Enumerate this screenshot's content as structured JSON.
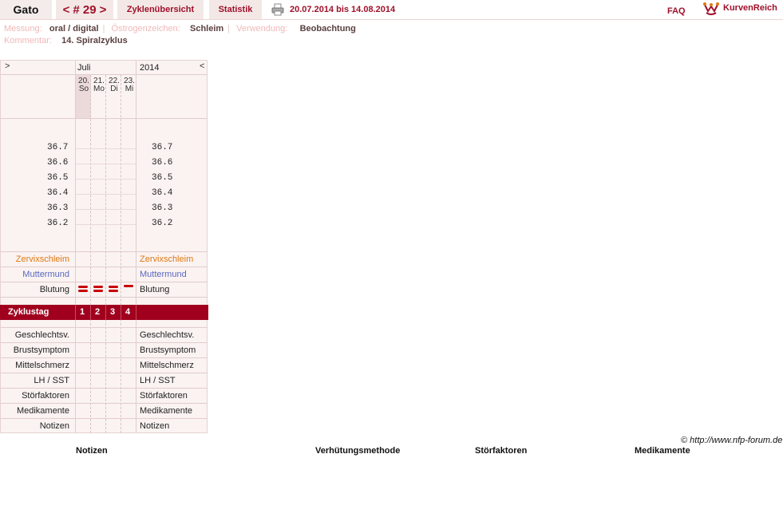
{
  "topbar": {
    "user": "Gato",
    "cycle_prev": "<",
    "cycle_label": "# 29",
    "cycle_next": ">",
    "overview_tab": "Zyklenübersicht",
    "stats_tab": "Statistik",
    "printer_icon": "printer-icon",
    "date_range": "20.07.2014 bis 14.08.2014",
    "faq": "FAQ",
    "logo_icon": "crown-icon",
    "logo_text": "KurvenReich"
  },
  "meta": {
    "messung_label": "Messung:",
    "messung_value": "oral / digital",
    "oestrogen_label": "Östrogenzeichen:",
    "oestrogen_value": "Schleim",
    "verwendung_label": "Verwendung:",
    "verwendung_value": "Beobachtung",
    "kommentar_label": "Kommentar:",
    "kommentar_value": "14. Spiralzyklus"
  },
  "chart": {
    "nav_left": ">",
    "nav_right": "<",
    "month": "Juli",
    "year": "2014",
    "days": [
      {
        "date": "20.",
        "weekday": "So",
        "bleeding": "heavy"
      },
      {
        "date": "21.",
        "weekday": "Mo",
        "bleeding": "heavy"
      },
      {
        "date": "22.",
        "weekday": "Di",
        "bleeding": "heavy"
      },
      {
        "date": "23.",
        "weekday": "Mi",
        "bleeding": "light"
      }
    ],
    "temperatures": [
      "36.7",
      "36.6",
      "36.5",
      "36.4",
      "36.3",
      "36.2"
    ],
    "rows_top": {
      "cervix": "Zervixschleim",
      "muttermund": "Muttermund",
      "blutung": "Blutung"
    },
    "zyklustag_label": "Zyklustag",
    "zyklustage": [
      "1",
      "2",
      "3",
      "4"
    ],
    "rows_bottom": [
      "Geschlechtsv.",
      "Brustsymptom",
      "Mittelschmerz",
      "LH / SST",
      "Störfaktoren",
      "Medikamente",
      "Notizen"
    ]
  },
  "footer": {
    "copyright": "© http://www.nfp-forum.de",
    "headings": [
      "Notizen",
      "Verhütungsmethode",
      "Störfaktoren",
      "Medikamente"
    ]
  },
  "colors": {
    "accent": "#a0102a",
    "zyklus_bar": "#a0001e",
    "cervix": "#e07810",
    "muttermund": "#5a68c0",
    "bleeding": "#c80000",
    "panel_bg": "#faf3f2"
  }
}
